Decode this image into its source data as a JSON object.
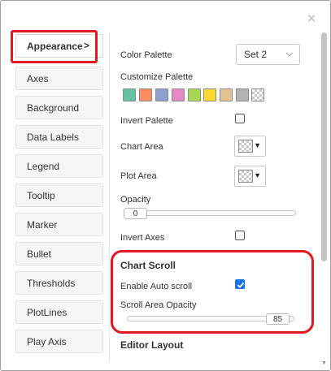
{
  "close_glyph": "×",
  "sidebar": {
    "items": [
      {
        "label": "Appearance",
        "chevron": ">",
        "active": true
      },
      {
        "label": "Axes"
      },
      {
        "label": "Background"
      },
      {
        "label": "Data Labels"
      },
      {
        "label": "Legend"
      },
      {
        "label": "Tooltip"
      },
      {
        "label": "Marker"
      },
      {
        "label": "Bullet"
      },
      {
        "label": "Thresholds"
      },
      {
        "label": "PlotLines"
      },
      {
        "label": "Play Axis"
      }
    ]
  },
  "appearance": {
    "color_palette": {
      "label": "Color Palette",
      "value": "Set 2"
    },
    "customize_palette": {
      "label": "Customize Palette",
      "colors": [
        "#66c2a5",
        "#fc8d62",
        "#8da0cb",
        "#e78ac3",
        "#a6d854",
        "#ffd92f",
        "#e5c494",
        "#b3b3b3",
        "transparent"
      ]
    },
    "invert_palette": {
      "label": "Invert Palette",
      "checked": false
    },
    "chart_area": {
      "label": "Chart Area"
    },
    "plot_area": {
      "label": "Plot Area"
    },
    "opacity": {
      "label": "Opacity",
      "value": "0"
    },
    "invert_axes": {
      "label": "Invert Axes",
      "checked": false
    }
  },
  "chart_scroll": {
    "title": "Chart Scroll",
    "enable_auto_scroll": {
      "label": "Enable Auto scroll",
      "checked": true
    },
    "scroll_area_opacity": {
      "label": "Scroll Area Opacity",
      "value": "85"
    }
  },
  "editor_layout": {
    "title": "Editor Layout"
  },
  "colors": {
    "accent": "#1a73e8",
    "highlight": "#e0191f"
  }
}
